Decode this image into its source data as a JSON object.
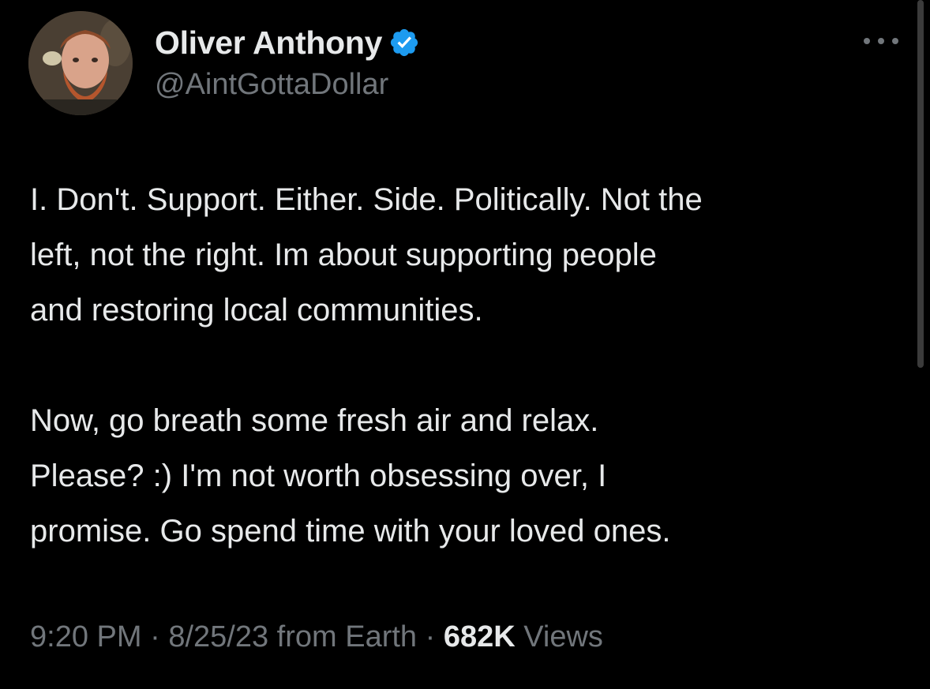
{
  "author": {
    "display_name": "Oliver Anthony",
    "handle": "@AintGottaDollar",
    "verified": true,
    "verified_color": "#1d9bf0"
  },
  "tweet": {
    "paragraphs": [
      {
        "lines": [
          "I. Don't. Support. Either. Side. Politically. Not the",
          "left, not the right. Im about supporting people",
          "and restoring local communities."
        ]
      },
      {
        "lines": [
          "Now, go breath some fresh air and relax.",
          "Please? :)  I'm not worth obsessing over, I",
          "promise. Go spend time with your loved ones."
        ]
      }
    ]
  },
  "meta": {
    "time": "9:20 PM",
    "separator": "·",
    "date": "8/25/23",
    "source": "from Earth",
    "views_count": "682K",
    "views_label": "Views"
  },
  "icons": {
    "more": "more-horizontal-icon",
    "verified": "verified-badge-icon"
  },
  "colors": {
    "background": "#000000",
    "primary_text": "#e7e9ea",
    "secondary_text": "#71767b"
  }
}
